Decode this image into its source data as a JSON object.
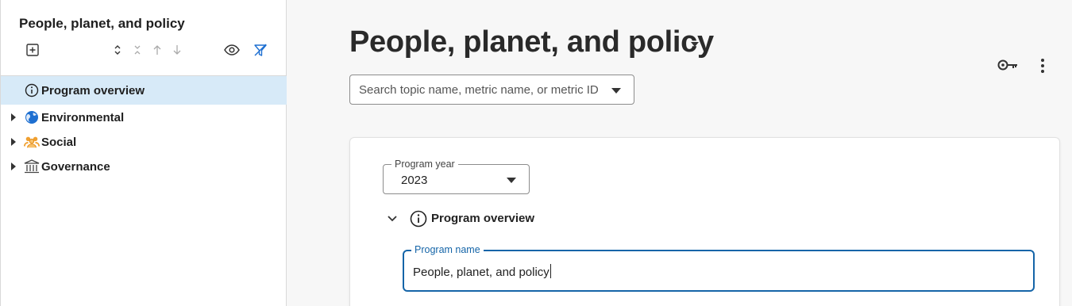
{
  "sidebar": {
    "title": "People, planet, and policy",
    "toolbar": [
      {
        "name": "add-icon"
      },
      {
        "name": "expand-collapse-icon"
      },
      {
        "name": "collapse-all-icon"
      },
      {
        "name": "arrow-up-icon"
      },
      {
        "name": "arrow-down-icon"
      },
      {
        "name": "eye-icon"
      },
      {
        "name": "filter-off-icon"
      }
    ],
    "items": [
      {
        "label": "Program overview",
        "icon": "info-icon",
        "selected": true
      },
      {
        "label": "Environmental",
        "icon": "globe-icon"
      },
      {
        "label": "Social",
        "icon": "people-icon"
      },
      {
        "label": "Governance",
        "icon": "building-icon"
      }
    ]
  },
  "main": {
    "title": "People, planet, and policy",
    "search_placeholder": "Search topic name, metric name, or metric ID",
    "program_year": {
      "label": "Program year",
      "value": "2023"
    },
    "section_title": "Program overview",
    "program_name": {
      "label": "Program name",
      "value": "People, planet, and policy"
    }
  },
  "colors": {
    "accent": "#1565a8",
    "selected_bg": "#d7eaf8",
    "globe": "#1d6fd1",
    "people": "#f0a030"
  }
}
